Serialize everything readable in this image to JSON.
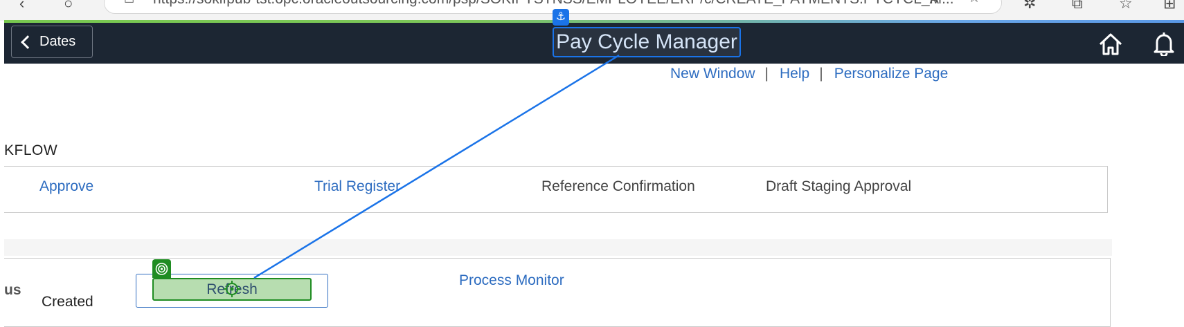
{
  "browser": {
    "url": "https://sokifpub-tst.opc.oracleoutsourcing.com/psp/SOKIFYSTNSS/EMPLOYEE/ERP/c/CREATE_PAYMENTS.PYCYCL_M..."
  },
  "header": {
    "back_label": "Dates",
    "title": "Pay Cycle Manager",
    "home_icon": "home-icon",
    "notifications_icon": "bell-icon",
    "bg_color": "#1c2633"
  },
  "top_links": {
    "new_window": "New Window",
    "help": "Help",
    "personalize": "Personalize Page",
    "separator": "|"
  },
  "workflow": {
    "label": "KFLOW",
    "items": [
      {
        "label": "Approve",
        "link": true
      },
      {
        "label": "Trial Register",
        "link": true
      },
      {
        "label": "Reference Confirmation",
        "link": false
      },
      {
        "label": "Draft Staging Approval",
        "link": false
      }
    ]
  },
  "status": {
    "label": "us",
    "value": "Created",
    "refresh_label": "Refresh",
    "process_monitor": "Process Monitor"
  },
  "overlay": {
    "anchor_icon": "anchor-icon",
    "target_icon": "target-icon",
    "accent_blue": "#1a73e8",
    "accent_green": "#1f8c22"
  }
}
